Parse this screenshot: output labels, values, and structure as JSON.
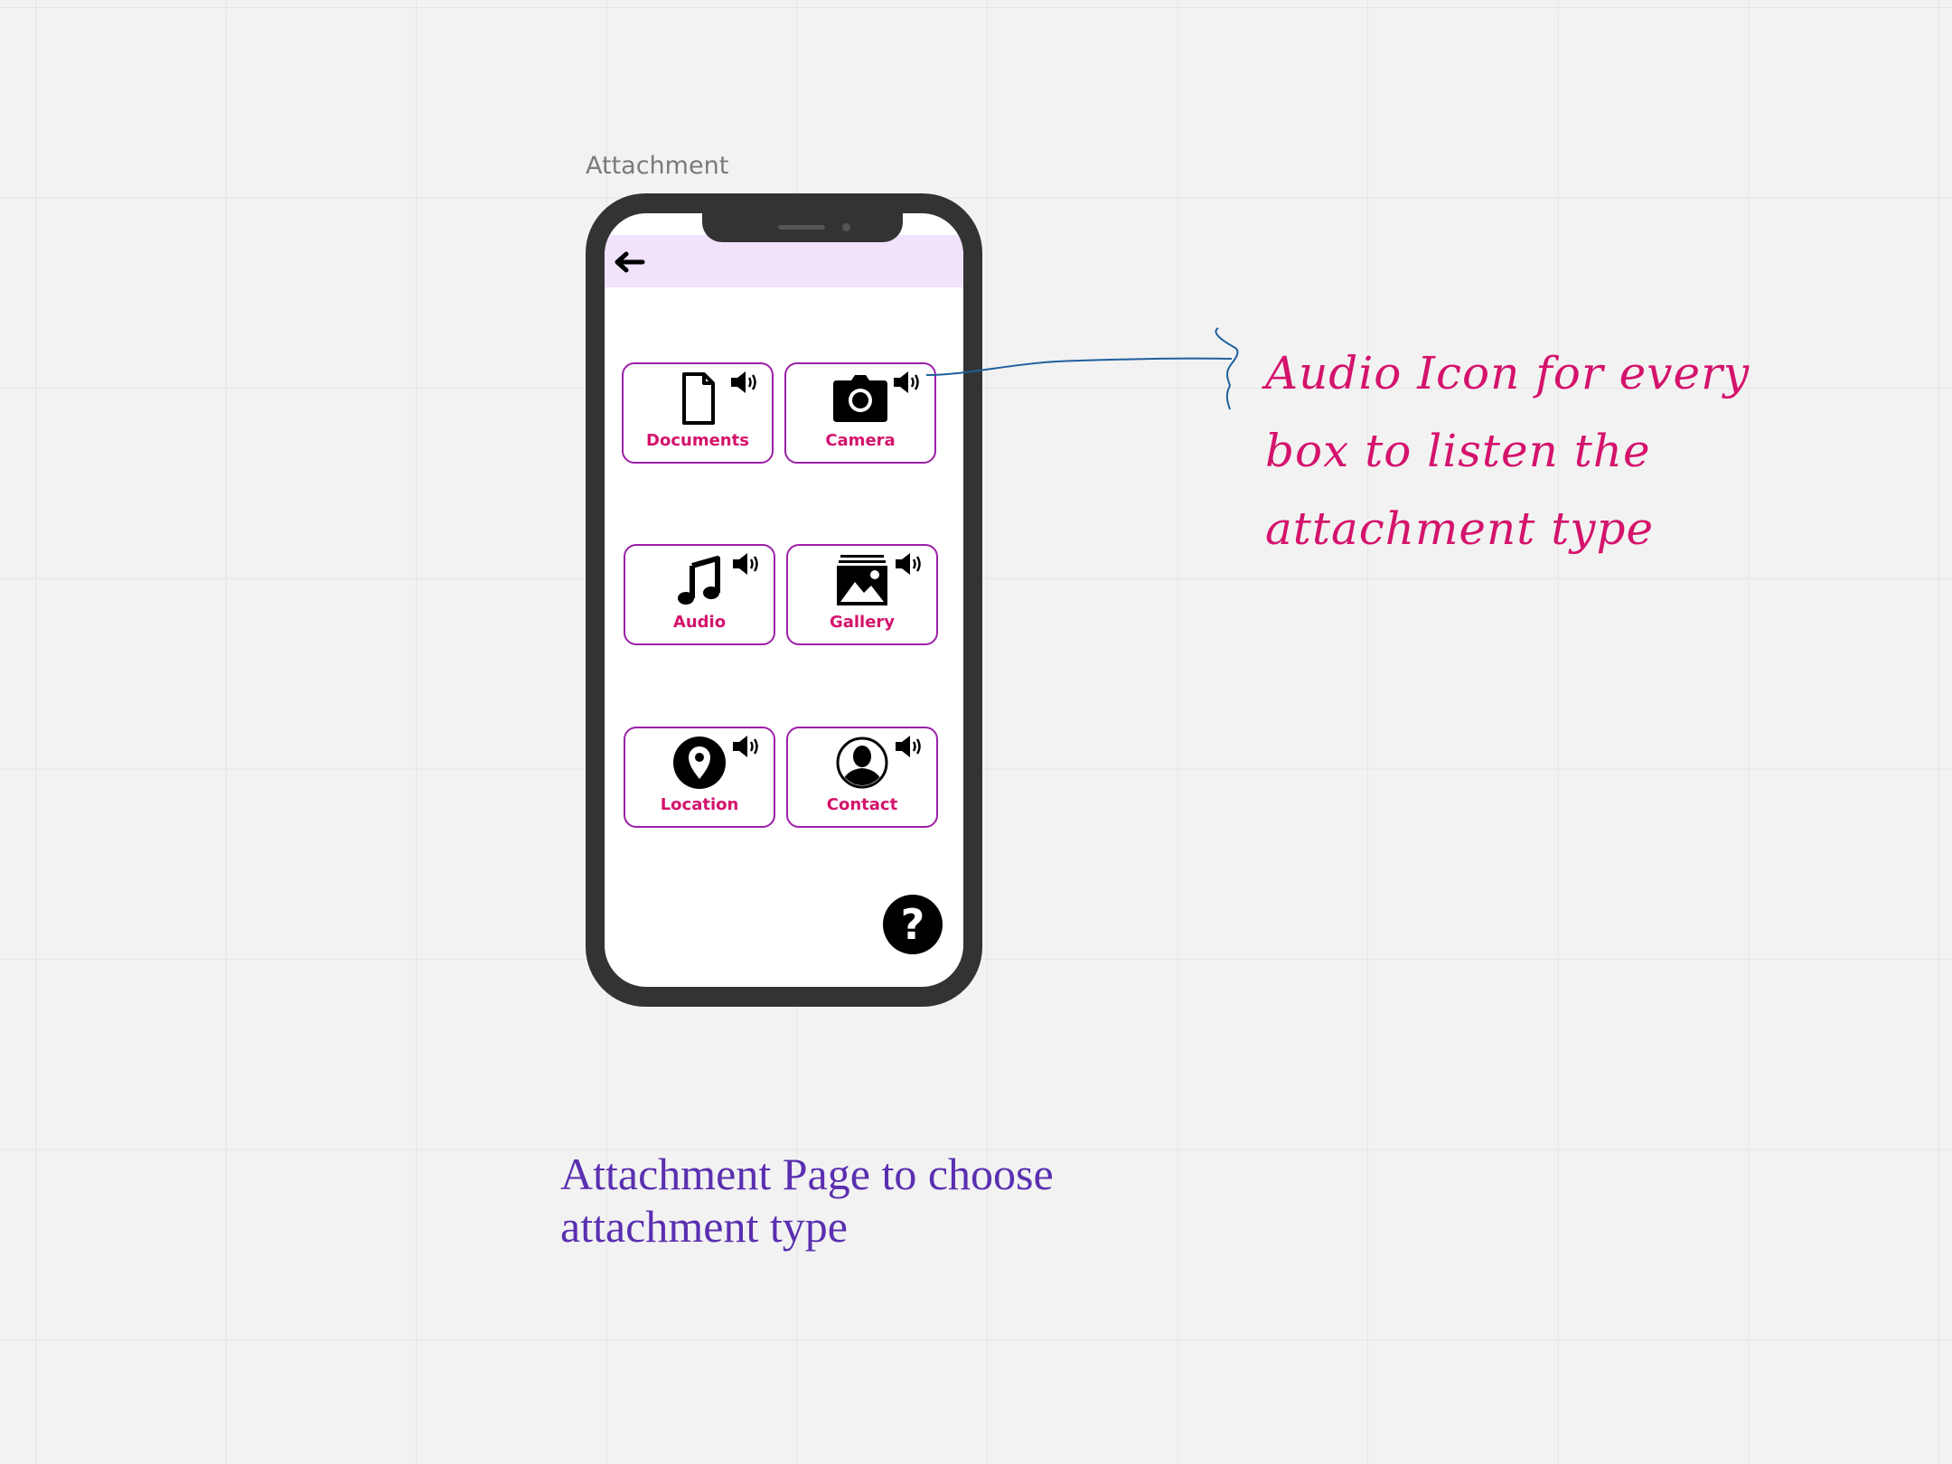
{
  "board": {
    "frame_label": "Attachment",
    "annotation": "Audio Icon for every box to listen the attachment type",
    "caption": "Attachment Page to choose attachment type"
  },
  "app": {
    "back_icon": "arrow-left-icon",
    "tiles": [
      {
        "label": "Documents",
        "icon": "document-icon",
        "sound_icon": "speaker-icon"
      },
      {
        "label": "Camera",
        "icon": "camera-icon",
        "sound_icon": "speaker-icon"
      },
      {
        "label": "Audio",
        "icon": "music-note-icon",
        "sound_icon": "speaker-icon"
      },
      {
        "label": "Gallery",
        "icon": "gallery-icon",
        "sound_icon": "speaker-icon"
      },
      {
        "label": "Location",
        "icon": "location-pin-icon",
        "sound_icon": "speaker-icon"
      },
      {
        "label": "Contact",
        "icon": "contact-icon",
        "sound_icon": "speaker-icon"
      }
    ],
    "help_glyph": "?",
    "help_icon": "question-mark-icon"
  },
  "colors": {
    "tile_border": "#9c1fa8",
    "tile_label": "#d4136c",
    "topbar": "#f0e3fb",
    "phone_body": "#333333",
    "annotation": "#d4136c",
    "caption": "#5a2fb0",
    "connector": "#1f5f9e"
  }
}
